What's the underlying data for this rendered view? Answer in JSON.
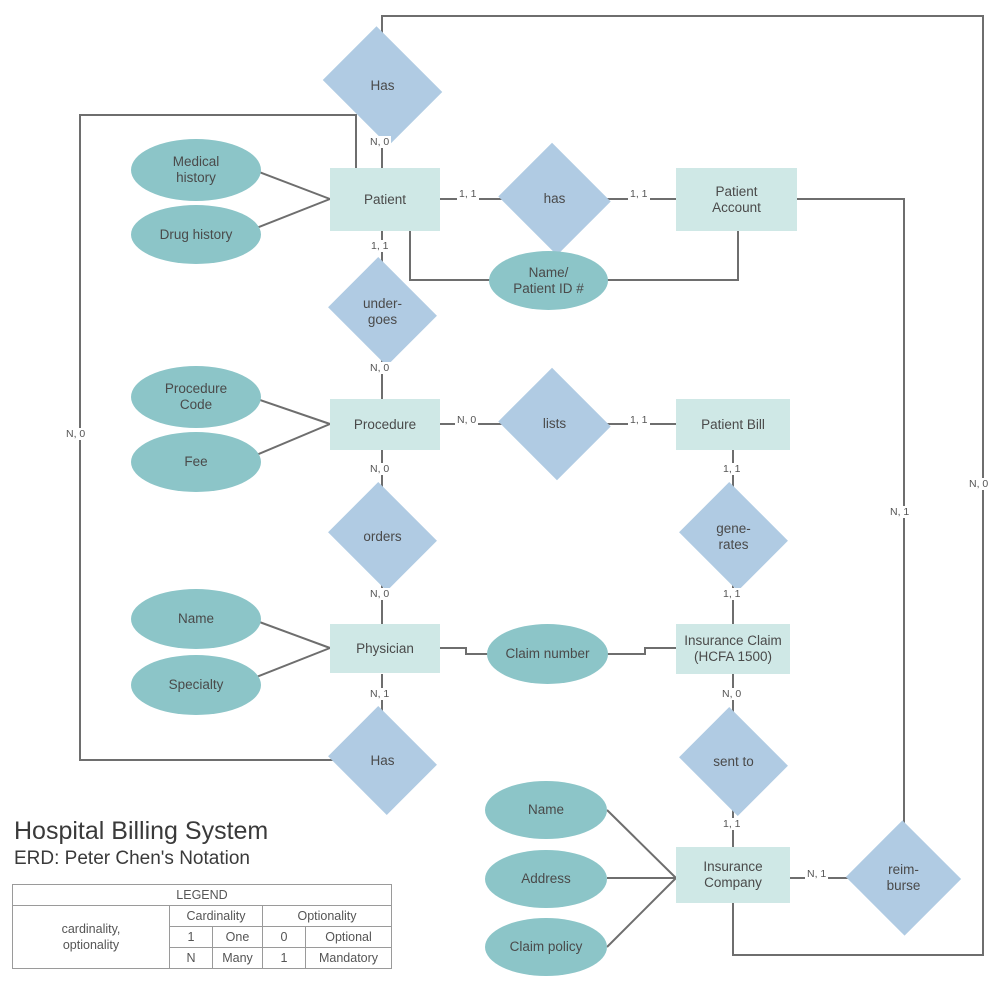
{
  "diagram": {
    "title": "Hospital Billing System",
    "subtitle": "ERD: Peter Chen's Notation"
  },
  "legend": {
    "header": "LEGEND",
    "row_label": "cardinality, optionality",
    "group_cardinality": "Cardinality",
    "group_optionality": "Optionality",
    "rows": [
      {
        "card_symbol": "1",
        "card_word": "One",
        "opt_symbol": "0",
        "opt_word": "Optional"
      },
      {
        "card_symbol": "N",
        "card_word": "Many",
        "opt_symbol": "1",
        "opt_word": "Mandatory"
      }
    ]
  },
  "entities": [
    {
      "id": "patient",
      "label": "Patient"
    },
    {
      "id": "patient_account",
      "label": "Patient Account"
    },
    {
      "id": "procedure",
      "label": "Procedure"
    },
    {
      "id": "patient_bill",
      "label": "Patient Bill"
    },
    {
      "id": "physician",
      "label": "Physician"
    },
    {
      "id": "insurance_claim",
      "label": "Insurance Claim (HCFA 1500)"
    },
    {
      "id": "insurance_company",
      "label": "Insurance Company"
    }
  ],
  "relationships": [
    {
      "id": "has_top",
      "label": "Has"
    },
    {
      "id": "has_patient_account",
      "label": "has"
    },
    {
      "id": "undergoes",
      "label": "under-goes"
    },
    {
      "id": "lists",
      "label": "lists"
    },
    {
      "id": "orders",
      "label": "orders"
    },
    {
      "id": "generates",
      "label": "gene-rates"
    },
    {
      "id": "has_bottom",
      "label": "Has"
    },
    {
      "id": "sent_to",
      "label": "sent to"
    },
    {
      "id": "reimburse",
      "label": "reim-burse"
    }
  ],
  "attributes": [
    {
      "id": "medical_history",
      "label": "Medical history"
    },
    {
      "id": "drug_history",
      "label": "Drug history"
    },
    {
      "id": "name_patient_id",
      "label": "Name/ Patient ID #"
    },
    {
      "id": "procedure_code",
      "label": "Procedure Code"
    },
    {
      "id": "fee",
      "label": "Fee"
    },
    {
      "id": "physician_name",
      "label": "Name"
    },
    {
      "id": "specialty",
      "label": "Specialty"
    },
    {
      "id": "claim_number",
      "label": "Claim number"
    },
    {
      "id": "ic_name",
      "label": "Name"
    },
    {
      "id": "ic_address",
      "label": "Address"
    },
    {
      "id": "ic_claim_policy",
      "label": "Claim policy"
    }
  ],
  "cardinalities": [
    {
      "id": "c-has-top-patient",
      "text": "N, 0"
    },
    {
      "id": "c-patient-has",
      "text": "1, 1"
    },
    {
      "id": "c-has-account",
      "text": "1, 1"
    },
    {
      "id": "c-patient-undergoes",
      "text": "1, 1"
    },
    {
      "id": "c-undergoes-procedure",
      "text": "N, 0"
    },
    {
      "id": "c-procedure-lists",
      "text": "N, 0"
    },
    {
      "id": "c-lists-bill",
      "text": "1, 1"
    },
    {
      "id": "c-procedure-orders",
      "text": "N, 0"
    },
    {
      "id": "c-orders-physician",
      "text": "N, 0"
    },
    {
      "id": "c-bill-generates",
      "text": "1, 1"
    },
    {
      "id": "c-generates-claim",
      "text": "1, 1"
    },
    {
      "id": "c-physician-has",
      "text": "N, 1"
    },
    {
      "id": "c-claim-sentto",
      "text": "N, 0"
    },
    {
      "id": "c-sentto-company",
      "text": "1, 1"
    },
    {
      "id": "c-company-reimburse",
      "text": "N, 1"
    },
    {
      "id": "c-left-loop",
      "text": "N, 0"
    },
    {
      "id": "c-right-inner",
      "text": "N, 1"
    },
    {
      "id": "c-right-outer",
      "text": "N, 0"
    }
  ],
  "colors": {
    "entity_fill": "#cfe8e6",
    "relationship_fill": "#b0cbe3",
    "attribute_fill": "#8cc5c8",
    "line": "#6e6e6e",
    "text": "#4a4a4a"
  }
}
